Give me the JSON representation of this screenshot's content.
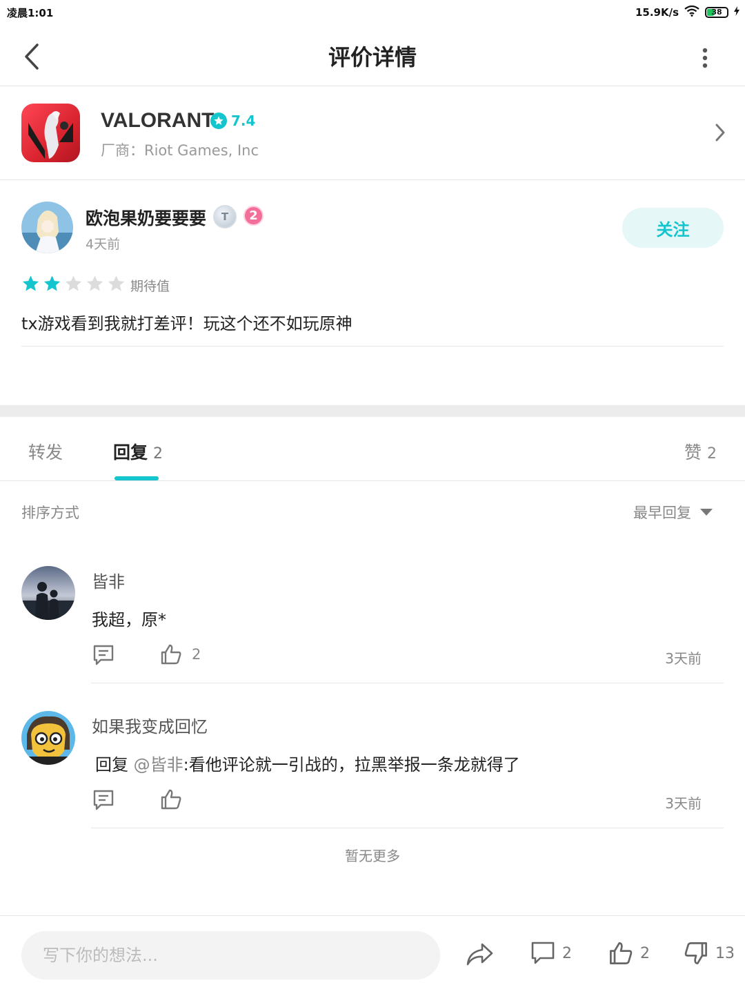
{
  "status_bar": {
    "time": "凌晨1:01",
    "speed": "15.9K/s",
    "battery": "38"
  },
  "header": {
    "title": "评价详情"
  },
  "app": {
    "name": "VALORANT",
    "score": "7.4",
    "vendor": "厂商：Riot Games, Inc"
  },
  "review": {
    "author": "欧泡果奶要要要",
    "level_badge": "T",
    "rank_badge": "2",
    "time": "4天前",
    "follow_label": "关注",
    "rating": 2,
    "rating_max": 5,
    "rating_label": "期待值",
    "text": "tx游戏看到我就打差评！玩这个还不如玩原神"
  },
  "tabs": {
    "forward": "转发",
    "reply": "回复",
    "reply_count": "2",
    "like": "赞",
    "like_count": "2"
  },
  "sort": {
    "label": "排序方式",
    "value": "最早回复"
  },
  "comments": [
    {
      "author": "皆非",
      "text": "我超，原*",
      "likes": "2",
      "time": "3天前"
    },
    {
      "author": "如果我变成回忆",
      "reply_prefix": "回复 ",
      "mention": "@皆非",
      "text": ":看他评论就一引战的，拉黑举报一条龙就得了",
      "likes": "",
      "time": "3天前"
    }
  ],
  "no_more": "暂无更多",
  "bottom_bar": {
    "input_placeholder": "写下你的想法...",
    "comment_count": "2",
    "like_count": "2",
    "dislike_count": "13"
  },
  "colors": {
    "accent": "#15c5ce",
    "star_empty": "#dcdcdc"
  }
}
